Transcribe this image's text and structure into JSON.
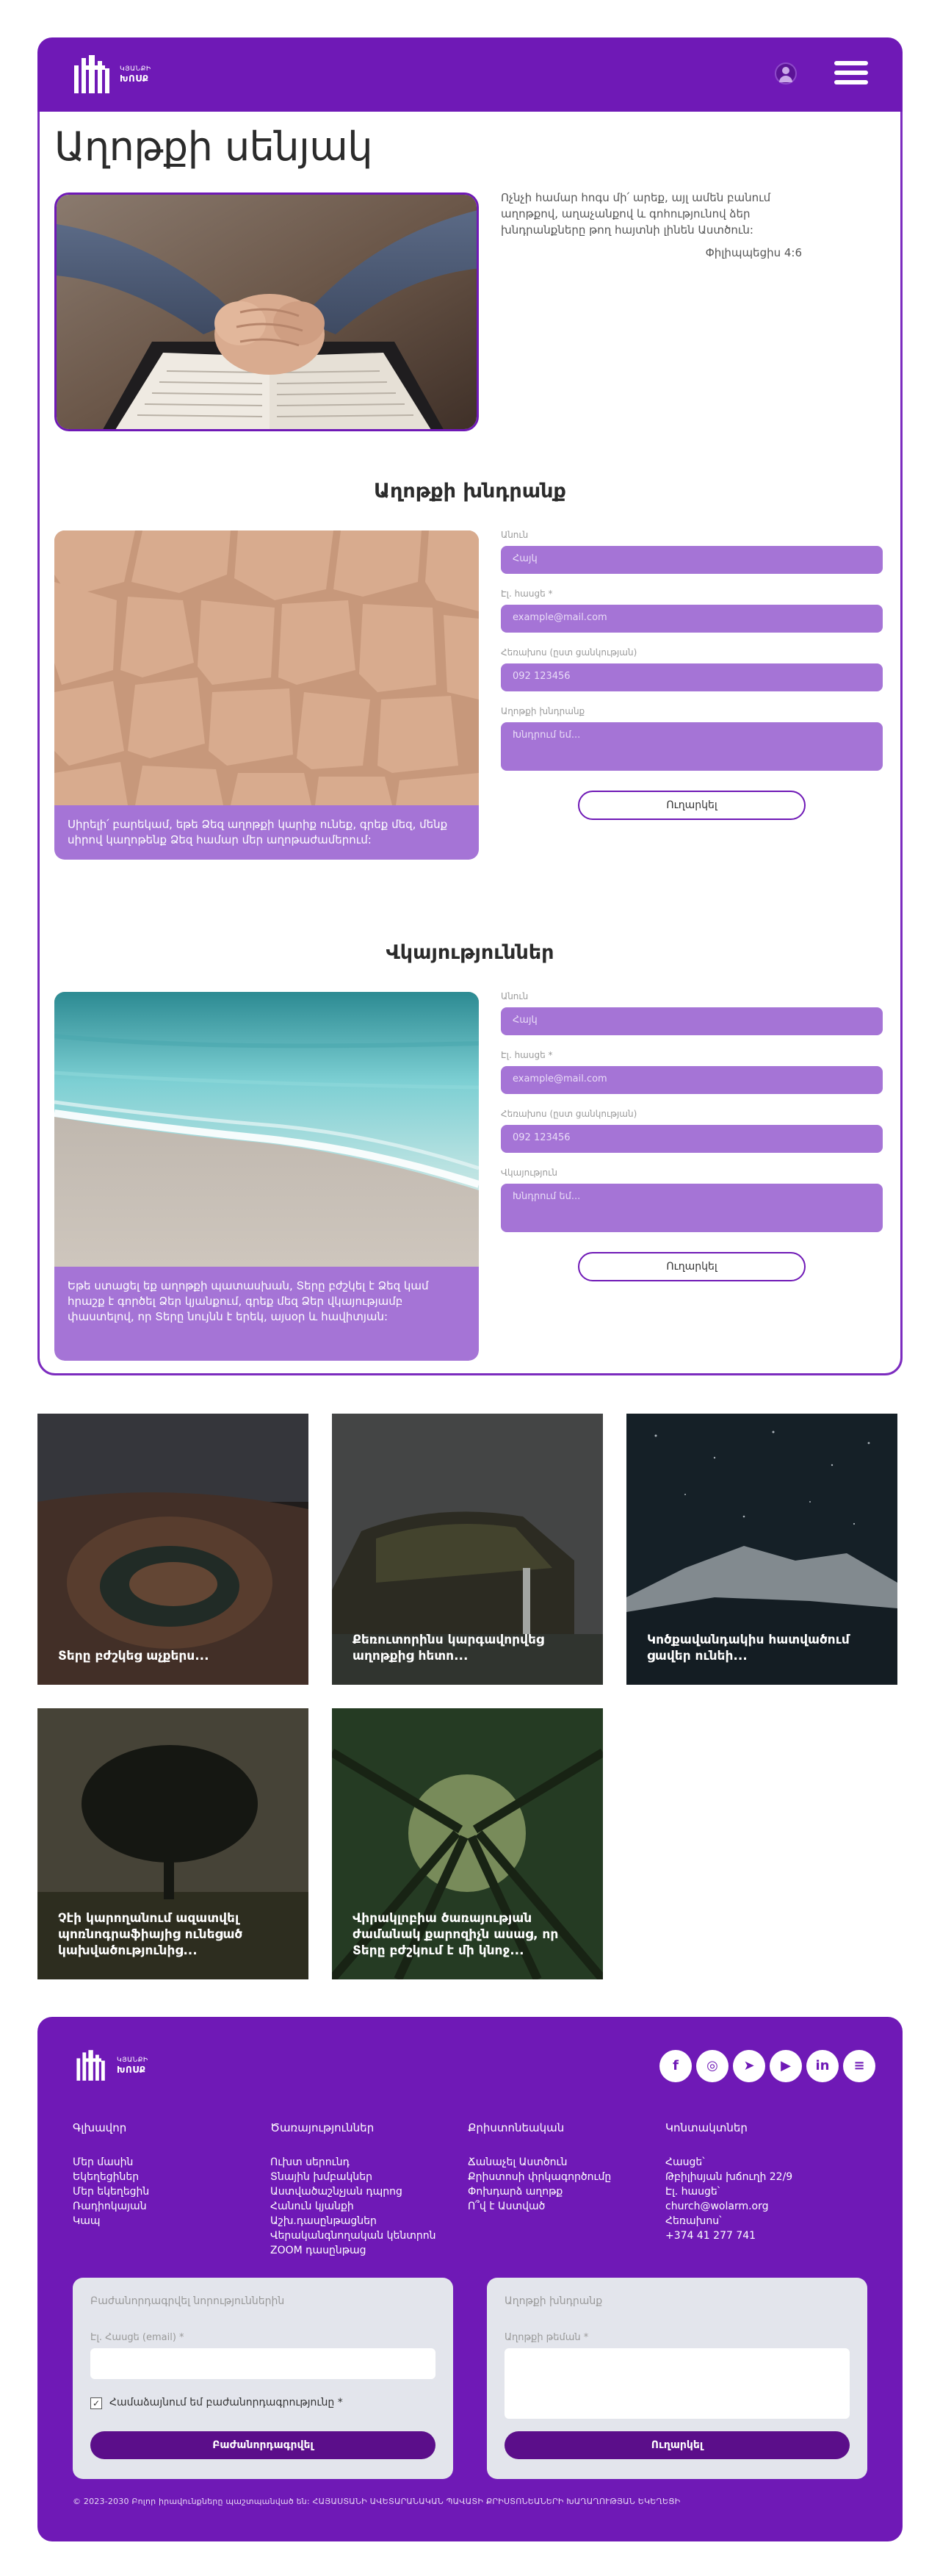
{
  "header": {
    "logo_line1": "ԿՅԱՆՔԻ",
    "logo_line2": "ԽՈՍՔ",
    "user_icon": "user-circle-icon",
    "menu_icon": "hamburger-menu-icon"
  },
  "page": {
    "title": "Աղոթքի սենյակ",
    "intro_text": "Ոչնչի համար հոգս մի՛ արեք, այլ ամեն բանում աղոթքով, աղաչանքով և գոհությունով ձեր խնդրանքները թող հայտնի լինեն Աստծուն:",
    "intro_ref": "Փիլիպպեցիս 4:6"
  },
  "prayer": {
    "section_title": "Աղոթքի խնդրանք",
    "caption": "Սիրելի՛ բարեկամ, եթե Ձեզ աղոթքի կարիք ունեք, գրեք մեզ, մենք սիրով կաղոթենք Ձեզ համար մեր աղոթաժամերում:",
    "name_label": "Անուն",
    "name_placeholder": "Հայկ",
    "email_label": "Էլ. հասցե *",
    "email_placeholder": "example@mail.com",
    "phone_label": "Հեռախոս (ըստ ցանկության)",
    "phone_placeholder": "092 123456",
    "request_label": "Աղոթքի խնդրանք",
    "request_placeholder": "Խնդրում եմ...",
    "submit_label": "Ուղարկել"
  },
  "testimony": {
    "section_title": "Վկայություններ",
    "caption": "Եթե ստացել եք աղոթքի պատասխան, Տերը բժշկել է Ձեզ կամ հրաշք է գործել Ձեր կյանքում, գրեք մեզ Ձեր վկայությամբ փաստելով, որ Տերը նույնն է երեկ, այսօր և հավիտյան:",
    "name_label": "Անուն",
    "name_placeholder": "Հայկ",
    "email_label": "Էլ. հասցե *",
    "email_placeholder": "example@mail.com",
    "phone_label": "Հեռախոս (ըստ ցանկության)",
    "phone_placeholder": "092 123456",
    "testimony_label": "Վկայություն",
    "testimony_placeholder": "Խնդրում եմ...",
    "submit_label": "Ուղարկել"
  },
  "tiles": [
    {
      "caption": "Տերը բժշկեց աչքերս..."
    },
    {
      "caption": "Քեռուտորինս կարգավորվեց աղոթքից հետո..."
    },
    {
      "caption": "Կոծքավանդակիս հատվածում ցավեր ունեի..."
    },
    {
      "caption": "Չէի կարողանում ազատվել պոռնոգրաֆիայից ունեցած կախվածությունից..."
    },
    {
      "caption": "Վիրակլոբիա ծառայության ժամանակ քարոզիչն ասաց, որ Տերը բժշկում է մի կնոջ..."
    }
  ],
  "footer": {
    "logo_line1": "ԿՅԱՆՔԻ",
    "logo_line2": "ԽՈՍՔ",
    "social": [
      {
        "icon": "facebook-icon",
        "glyph": "f"
      },
      {
        "icon": "instagram-icon",
        "glyph": "◎"
      },
      {
        "icon": "telegram-icon",
        "glyph": "➤"
      },
      {
        "icon": "youtube-icon",
        "glyph": "▶"
      },
      {
        "icon": "linkedin-icon",
        "glyph": "in"
      },
      {
        "icon": "menu-circle-icon",
        "glyph": "≡"
      }
    ],
    "columns": [
      {
        "title": "Գլխավոր",
        "items": [
          "Մեր մասին",
          "Եկեղեցիներ",
          "Մեր եկեղեցին",
          "Ռադիոկայան",
          "Կապ"
        ]
      },
      {
        "title": "Ծառայություններ",
        "items": [
          "Ուխտ սերունդ",
          "Տնային խմբակներ",
          "Աստվածաշնչյան դպրոց",
          "Հանուն կյանքի",
          "Աշխ.դասընթացներ",
          "Վերականգնողական կենտրոն",
          "ZOOM դասընթաց"
        ]
      },
      {
        "title": "Քրիստոնեական",
        "items": [
          "Ճանաչել Աստծուն",
          "Քրիստոսի փրկագործումը",
          "Փոխդարձ աղոթք",
          "Ո՞վ է Աստված"
        ]
      },
      {
        "title": "Կոնտակտներ",
        "items": [
          "Հասցե՝",
          "Թբիլիսյան խճուղի 22/9",
          "Էլ. հասցե՝",
          "church@wolarm.org",
          "Հեռախոս՝",
          "+374 41 277 741"
        ]
      }
    ],
    "newsletter": {
      "title": "Բաժանորդագրվել նորություններին",
      "email_label": "Էլ. Հասցե (email) *",
      "consent_label": "Համաձայնում եմ բաժանորդագրությունը *",
      "button_label": "Բաժանորդագրվել"
    },
    "request": {
      "title": "Աղոթքի խնդրանք",
      "text_label": "Աղոթքի թեման *",
      "button_label": "Ուղարկել"
    },
    "copyright": "© 2023-2030 Բոլոր իրավունքները պաշտպանված են: ՀԱՅԱՍՏԱՆԻ ԱՎԵՏԱՐԱՆԱԿԱՆ ՊԱՎԱՏԻ ՔՐԻՍՏՈՆԵԱՆԵՐԻ ԽԱՂԱՂՈՒԹՅԱՆ ԵԿԵՂԵՑԻ"
  }
}
